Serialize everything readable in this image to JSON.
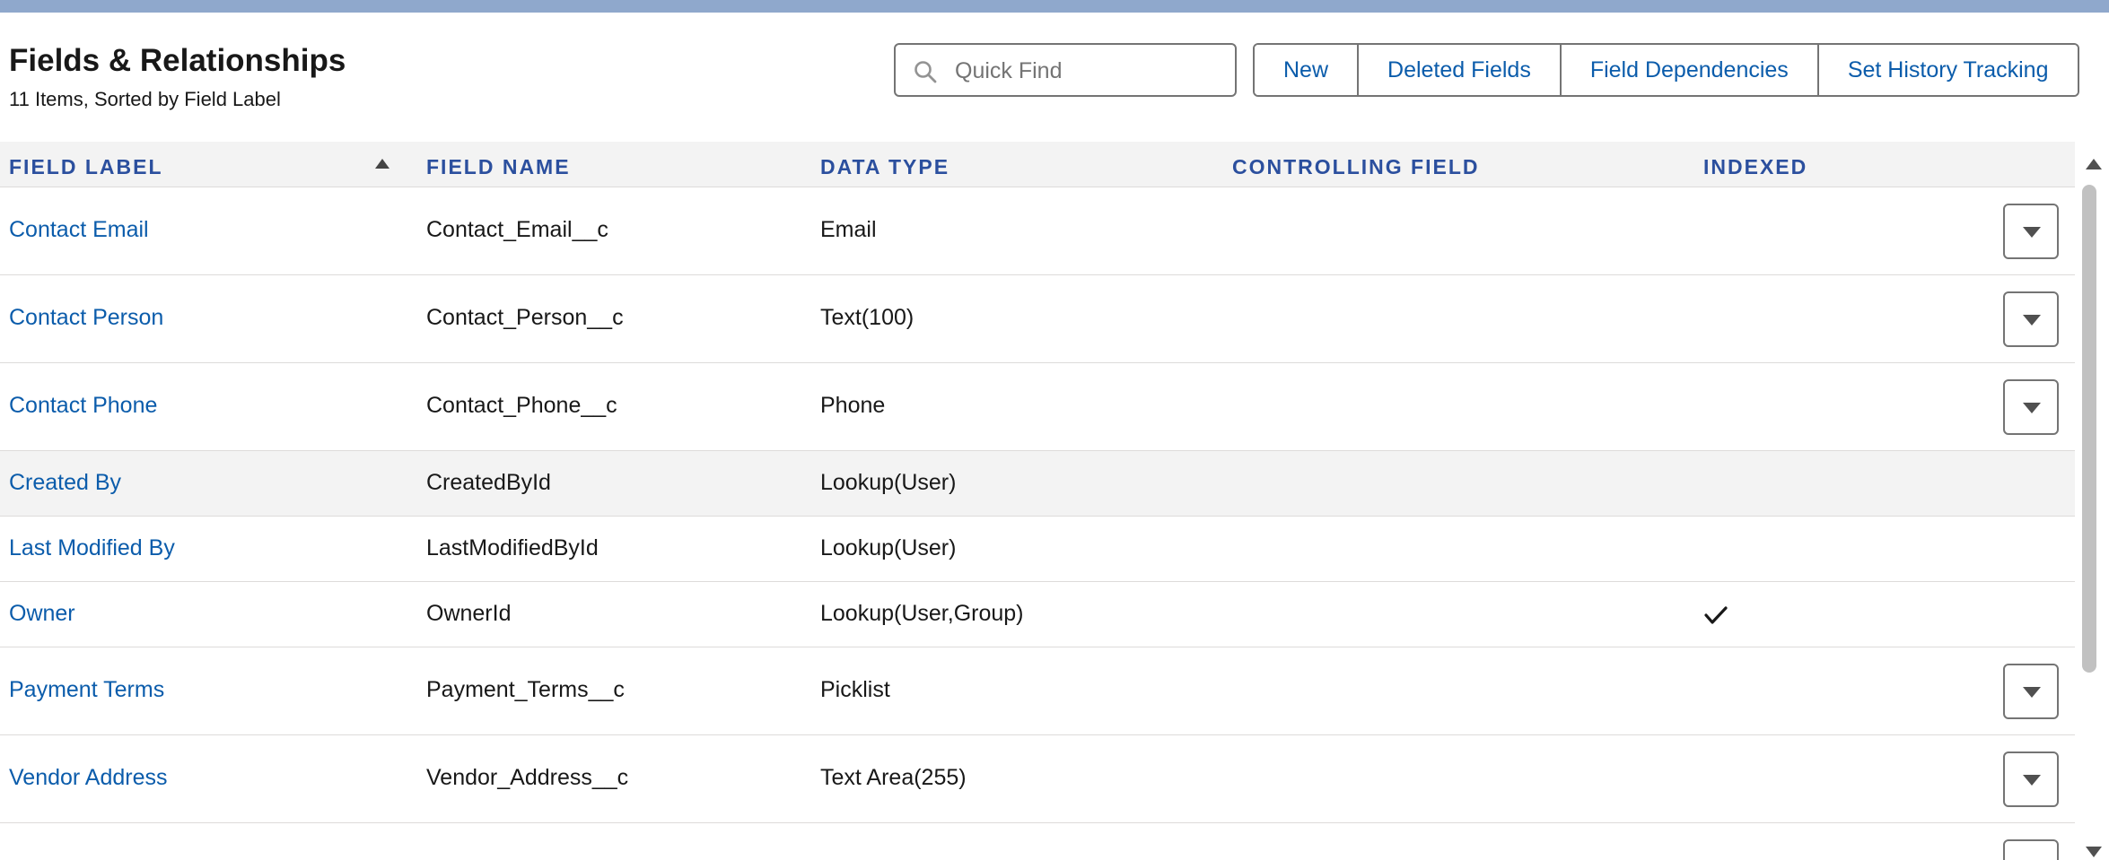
{
  "header": {
    "title": "Fields & Relationships",
    "subtitle": "11 Items, Sorted by Field Label"
  },
  "search": {
    "placeholder": "Quick Find",
    "icon": "search-icon"
  },
  "toolbar": {
    "new_label": "New",
    "deleted_fields_label": "Deleted Fields",
    "field_dependencies_label": "Field Dependencies",
    "history_tracking_label": "Set History Tracking"
  },
  "table": {
    "columns": {
      "field_label": "FIELD LABEL",
      "field_name": "FIELD NAME",
      "data_type": "DATA TYPE",
      "controlling_field": "CONTROLLING FIELD",
      "indexed": "INDEXED"
    },
    "sort": {
      "column": "field_label",
      "direction": "ascending"
    },
    "rows": [
      {
        "label": "Contact Email",
        "name": "Contact_Email__c",
        "type": "Email",
        "controlling": "",
        "indexed": false,
        "menu": true
      },
      {
        "label": "Contact Person",
        "name": "Contact_Person__c",
        "type": "Text(100)",
        "controlling": "",
        "indexed": false,
        "menu": true
      },
      {
        "label": "Contact Phone",
        "name": "Contact_Phone__c",
        "type": "Phone",
        "controlling": "",
        "indexed": false,
        "menu": true
      },
      {
        "label": "Created By",
        "name": "CreatedById",
        "type": "Lookup(User)",
        "controlling": "",
        "indexed": false,
        "menu": false
      },
      {
        "label": "Last Modified By",
        "name": "LastModifiedById",
        "type": "Lookup(User)",
        "controlling": "",
        "indexed": false,
        "menu": false
      },
      {
        "label": "Owner",
        "name": "OwnerId",
        "type": "Lookup(User,Group)",
        "controlling": "",
        "indexed": true,
        "menu": false
      },
      {
        "label": "Payment Terms",
        "name": "Payment_Terms__c",
        "type": "Picklist",
        "controlling": "",
        "indexed": false,
        "menu": true
      },
      {
        "label": "Vendor Address",
        "name": "Vendor_Address__c",
        "type": "Text Area(255)",
        "controlling": "",
        "indexed": false,
        "menu": true
      }
    ]
  },
  "colors": {
    "link": "#0b5cab",
    "header_text": "#2b4f9e",
    "border": "#747474",
    "highlight_row": "#f3f3f3"
  }
}
